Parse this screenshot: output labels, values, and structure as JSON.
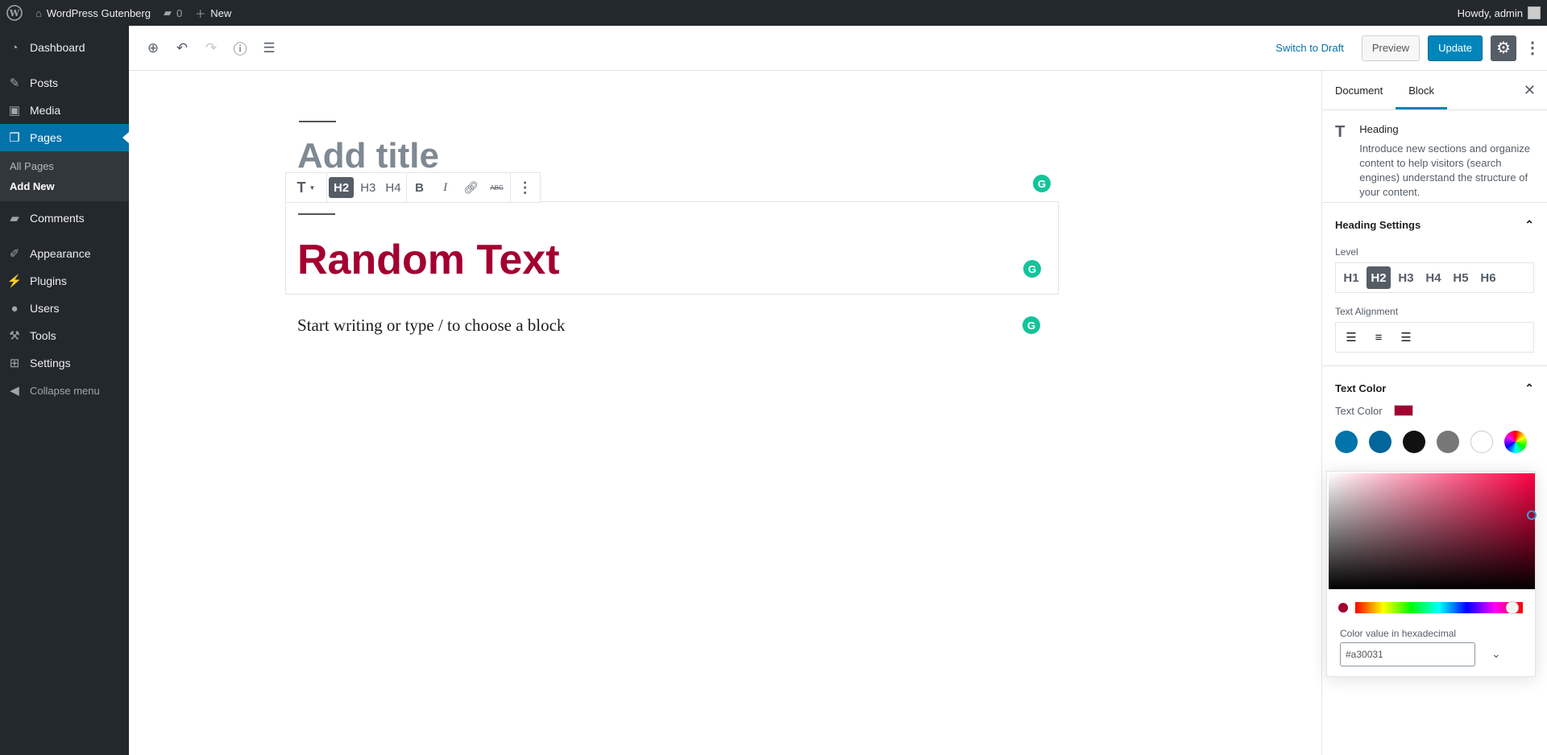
{
  "admin_bar": {
    "site_name": "WordPress Gutenberg",
    "comments_count": "0",
    "new_label": "New",
    "howdy": "Howdy, admin"
  },
  "sidebar": {
    "items": [
      {
        "label": "Dashboard",
        "icon": "dashboard-icon"
      },
      {
        "label": "Posts",
        "icon": "pin-icon"
      },
      {
        "label": "Media",
        "icon": "media-icon"
      },
      {
        "label": "Pages",
        "icon": "pages-icon",
        "active": true
      },
      {
        "label": "Comments",
        "icon": "comment-icon"
      },
      {
        "label": "Appearance",
        "icon": "brush-icon"
      },
      {
        "label": "Plugins",
        "icon": "plugin-icon"
      },
      {
        "label": "Users",
        "icon": "user-icon"
      },
      {
        "label": "Tools",
        "icon": "wrench-icon"
      },
      {
        "label": "Settings",
        "icon": "settings-icon"
      }
    ],
    "submenu": [
      "All Pages",
      "Add New"
    ],
    "collapse": "Collapse menu"
  },
  "header": {
    "switch_to_draft": "Switch to Draft",
    "preview": "Preview",
    "update": "Update"
  },
  "editor": {
    "title_placeholder": "Add title",
    "heading_text": "Random Text",
    "paragraph_placeholder": "Start writing or type / to choose a block",
    "heading_color": "#a30031",
    "toolbar": {
      "h2": "H2",
      "h3": "H3",
      "h4": "H4",
      "bold": "B",
      "italic": "I",
      "strike": "ABC"
    }
  },
  "settings_panel": {
    "tabs": [
      "Document",
      "Block"
    ],
    "active_tab": "Block",
    "block_card": {
      "title": "Heading",
      "description": "Introduce new sections and organize content to help visitors (search engines) understand the structure of your content."
    },
    "heading_settings": {
      "title": "Heading Settings",
      "level_label": "Level",
      "levels": [
        "H1",
        "H2",
        "H3",
        "H4",
        "H5",
        "H6"
      ],
      "active_level": "H2",
      "alignment_label": "Text Alignment"
    },
    "text_color": {
      "title": "Text Color",
      "label": "Text Color",
      "current": "#a30031",
      "palette": [
        "#0073aa",
        "#00669b",
        "#111111",
        "#777777",
        "#ffffff"
      ]
    },
    "picker": {
      "hex_label": "Color value in hexadecimal",
      "hex_value": "#a30031"
    }
  }
}
